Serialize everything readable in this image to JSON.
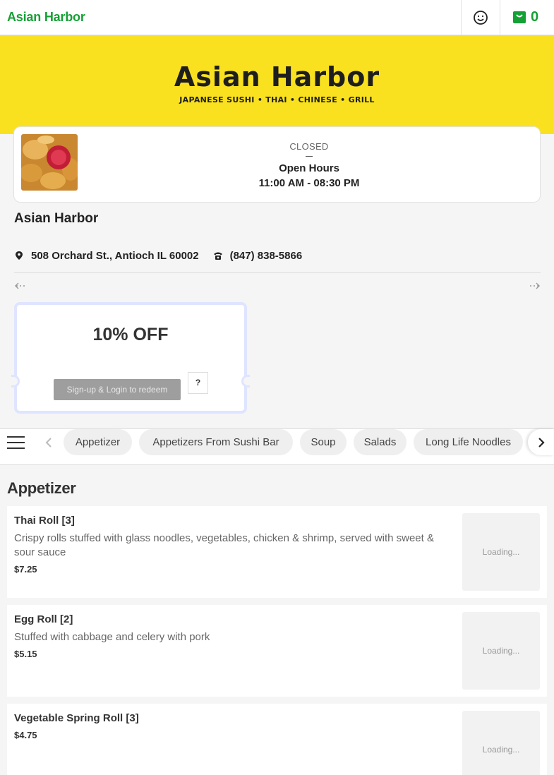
{
  "topbar": {
    "brand": "Asian Harbor",
    "cart_count": "0"
  },
  "hero": {
    "logo_title": "Asian Harbor",
    "logo_subtitle": "JAPANESE SUSHI • THAI • CHINESE • GRILL"
  },
  "info": {
    "status": "CLOSED",
    "open_hours_label": "Open Hours",
    "open_hours": "11:00 AM - 08:30 PM"
  },
  "restaurant": {
    "name": "Asian Harbor",
    "address": "508 Orchard St., Antioch IL 60002",
    "phone": "(847) 838-5866"
  },
  "coupon": {
    "title": "10% OFF",
    "redeem_label": "Sign-up & Login to redeem",
    "help_label": "?"
  },
  "categories": [
    "Appetizer",
    "Appetizers From Sushi Bar",
    "Soup",
    "Salads",
    "Long Life Noodles"
  ],
  "menu": {
    "section_title": "Appetizer",
    "items": [
      {
        "name": "Thai Roll [3]",
        "description": "Crispy rolls stuffed with glass noodles, vegetables, chicken & shrimp, served with sweet & sour sauce",
        "price": "$7.25",
        "image_status": "Loading..."
      },
      {
        "name": "Egg Roll [2]",
        "description": "Stuffed with cabbage and celery with pork",
        "price": "$5.15",
        "image_status": "Loading..."
      },
      {
        "name": "Vegetable Spring Roll [3]",
        "description": "",
        "price": "$4.75",
        "image_status": "Loading..."
      }
    ]
  },
  "colors": {
    "brand_green": "#15a035",
    "hero_yellow": "#f9e11f"
  }
}
